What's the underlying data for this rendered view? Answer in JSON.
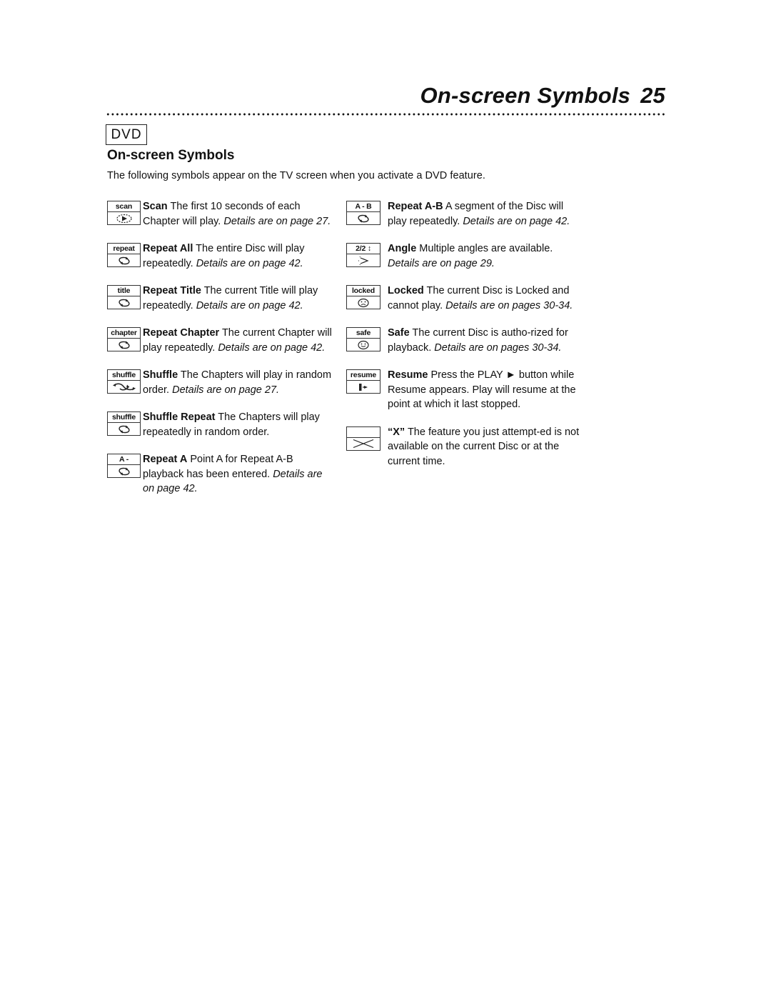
{
  "header": {
    "title": "On-screen Symbols",
    "page_number": "25"
  },
  "badge": "DVD",
  "section_title": "On-screen Symbols",
  "intro": "The following symbols appear on the TV screen when you activate a DVD feature.",
  "left_column": [
    {
      "symbol_label": "scan",
      "symbol_icon": "scan-play-icon",
      "name": "Scan",
      "desc": " The first 10 seconds of each Chapter will play. ",
      "details": "Details are on page 27."
    },
    {
      "symbol_label": "repeat",
      "symbol_icon": "repeat-arrows-icon",
      "name": "Repeat All",
      "desc": " The entire Disc will play repeatedly. ",
      "details": "Details are on page 42."
    },
    {
      "symbol_label": "title",
      "symbol_icon": "repeat-arrows-icon",
      "name": "Repeat Title",
      "desc": " The current Title will play repeatedly. ",
      "details": "Details are on page 42."
    },
    {
      "symbol_label": "chapter",
      "symbol_icon": "repeat-arrows-icon",
      "name": "Repeat Chapter",
      "desc": " The current Chapter will play repeatedly. ",
      "details": "Details are on page 42."
    },
    {
      "symbol_label": "shuffle",
      "symbol_icon": "shuffle-arrows-icon",
      "name": "Shuffle",
      "desc": " The Chapters will play in random order. ",
      "details": "Details are on page 27."
    },
    {
      "symbol_label": "shuffle",
      "symbol_icon": "repeat-arrows-icon",
      "name": "Shuffle Repeat",
      "desc": " The Chapters will play repeatedly in random order.",
      "details": ""
    },
    {
      "symbol_label": "A -",
      "symbol_icon": "repeat-arrows-icon",
      "name": "Repeat A",
      "desc": "  Point A for Repeat A-B playback has been entered. ",
      "details": "Details are on page 42."
    }
  ],
  "right_column": [
    {
      "symbol_label": "A - B",
      "symbol_icon": "repeat-arrows-icon",
      "name": "Repeat A-B",
      "desc": " A segment of the Disc will play repeatedly. ",
      "details": "Details are on page 42."
    },
    {
      "symbol_label": "2/2 ↕",
      "symbol_icon": "angle-camera-icon",
      "name": "Angle",
      "desc": " Multiple angles are available. ",
      "details": "Details are on page 29."
    },
    {
      "symbol_label": "locked",
      "symbol_icon": "sad-face-icon",
      "name": "Locked",
      "desc": " The current Disc is Locked and cannot play. ",
      "details": "Details are on pages 30-34."
    },
    {
      "symbol_label": "safe",
      "symbol_icon": "smiley-face-icon",
      "name": "Safe",
      "desc": " The current Disc is autho-rized for playback. ",
      "details": "Details are on pages 30-34."
    },
    {
      "symbol_label": "resume",
      "symbol_icon": "resume-play-icon",
      "name": "Resume",
      "desc": " Press the PLAY ► button while Resume appears. Play will resume at the point at which it last stopped.",
      "details": ""
    },
    {
      "symbol_label": "",
      "symbol_icon": "x-cross-icon",
      "name": "“X”",
      "desc": " The feature you just attempt-ed is not available on the current Disc or at the current time.",
      "details": ""
    }
  ]
}
